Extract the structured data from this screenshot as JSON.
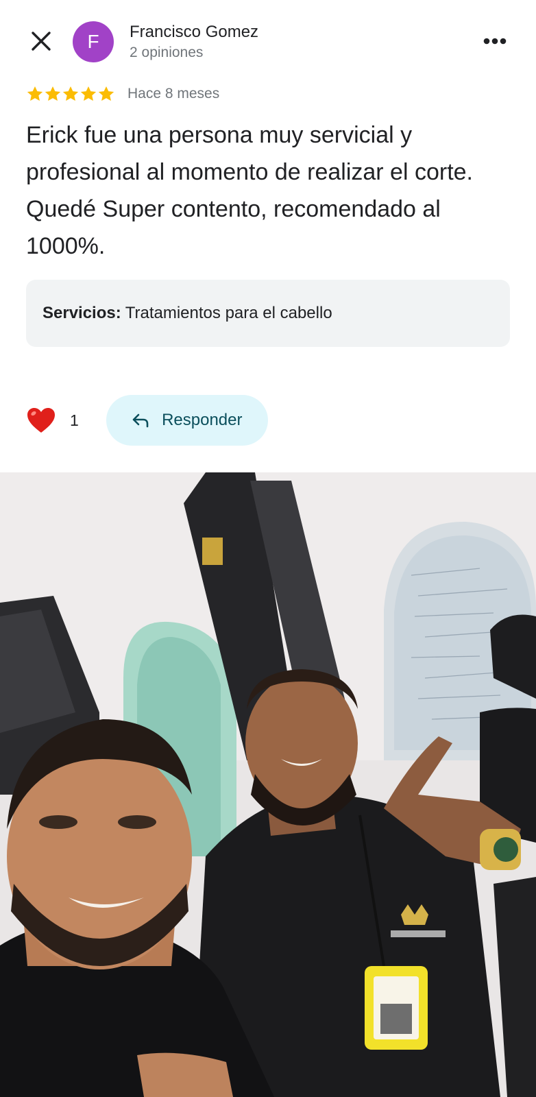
{
  "header": {
    "close_icon": "close-icon",
    "avatar_letter": "F",
    "avatar_color": "#a142c7",
    "reviewer_name": "Francisco Gomez",
    "review_count": "2 opiniones",
    "more_icon": "more-horizontal-icon"
  },
  "review": {
    "rating": 5,
    "rating_max": 5,
    "star_color": "#fbbc04",
    "time": "Hace 8 meses",
    "text": "Erick fue una persona muy servicial y profesional al momento de realizar el corte. Quedé Super contento, recomendado al 1000%."
  },
  "services": {
    "label": "Servicios:",
    "value": "Tratamientos para el cabello"
  },
  "actions": {
    "like_icon": "heart-icon",
    "like_count": "1",
    "reply_icon": "reply-arrow-icon",
    "reply_label": "Responder",
    "reply_bg": "#dff6fb"
  },
  "photo": {
    "subject": "selfie-photo"
  }
}
